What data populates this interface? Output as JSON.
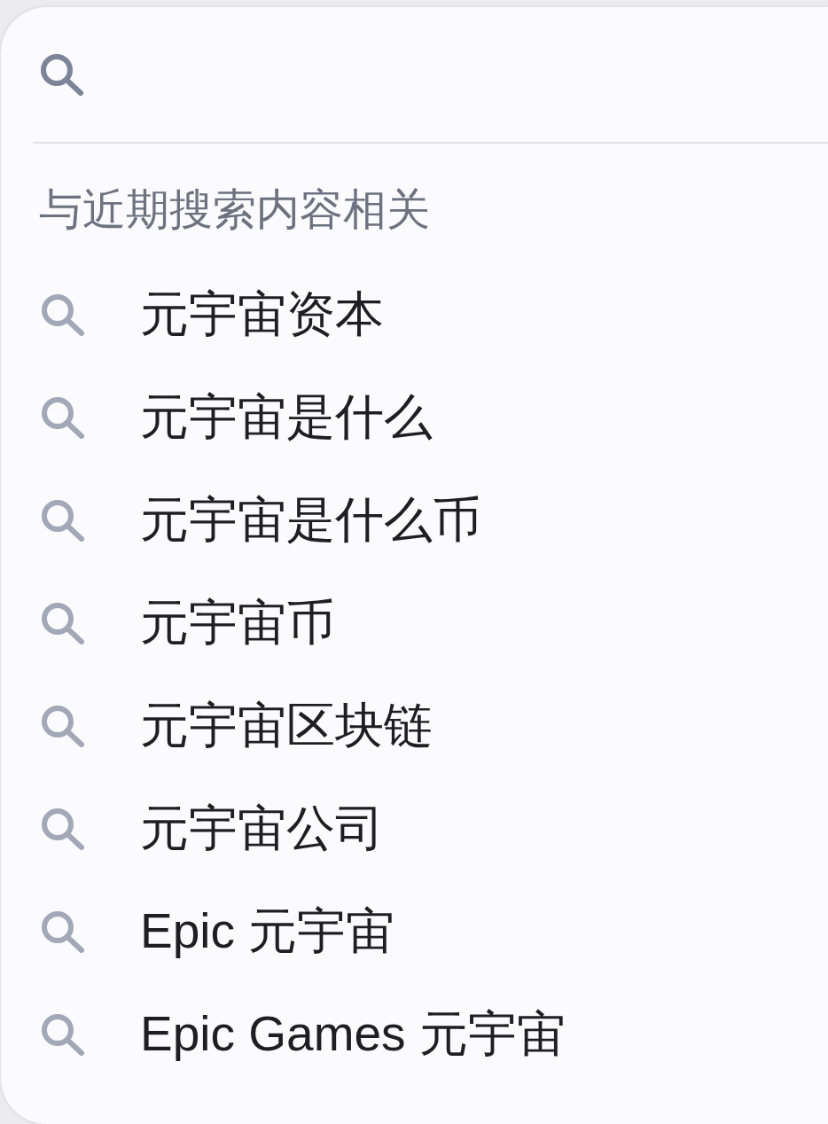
{
  "section_title": "与近期搜索内容相关",
  "suggestions": [
    "元宇宙资本",
    "元宇宙是什么",
    "元宇宙是什么币",
    "元宇宙币",
    "元宇宙区块链",
    "元宇宙公司",
    "Epic 元宇宙",
    "Epic Games 元宇宙"
  ]
}
